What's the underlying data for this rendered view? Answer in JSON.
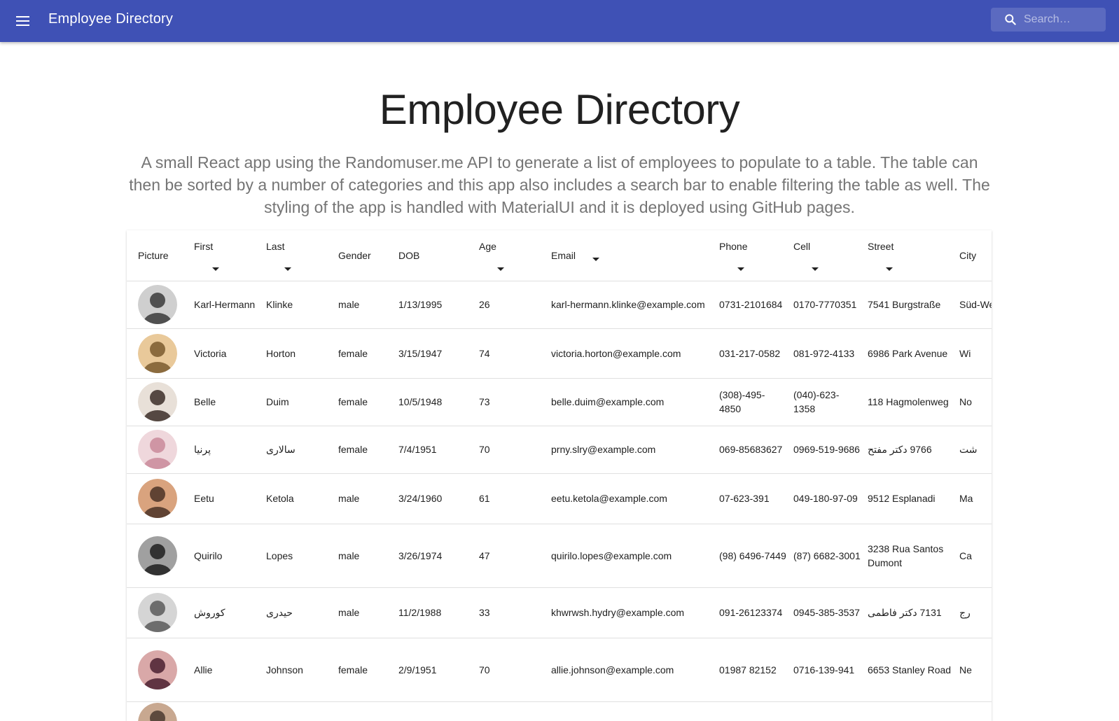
{
  "appbar": {
    "title": "Employee Directory",
    "menu_icon": "hamburger-menu-icon",
    "search_icon": "search-icon",
    "search_placeholder": "Search…",
    "search_value": ""
  },
  "hero": {
    "title": "Employee Directory",
    "description": "A small React app using the Randomuser.me API to generate a list of employees to populate to a table. The table can then be sorted by a number of categories and this app also includes a search bar to enable filtering the table as well. The styling of the app is handled with MaterialUI and it is deployed using GitHub pages."
  },
  "colors": {
    "appbar": "#3f51b5",
    "text": "#212121",
    "muted": "#757575",
    "divider": "#e0e0e0"
  },
  "table": {
    "columns": [
      "Picture",
      "First",
      "Last",
      "Gender",
      "DOB",
      "Age",
      "Email",
      "Phone",
      "Cell",
      "Street",
      "City"
    ],
    "sortable": [
      "First",
      "Last",
      "Age",
      "Email",
      "Phone",
      "Cell",
      "Street"
    ],
    "rows": [
      {
        "first": "Karl-Hermann",
        "last": "Klinke",
        "gender": "male",
        "dob": "1/13/1995",
        "age": "26",
        "email": "karl-hermann.klinke@example.com",
        "phone": "0731-2101684",
        "cell": "0170-7770351",
        "street": "7541 Burgstraße",
        "city": "Süd-West"
      },
      {
        "first": "Victoria",
        "last": "Horton",
        "gender": "female",
        "dob": "3/15/1947",
        "age": "74",
        "email": "victoria.horton@example.com",
        "phone": "031-217-0582",
        "cell": "081-972-4133",
        "street": "6986 Park Avenue",
        "city": "Wi"
      },
      {
        "first": "Belle",
        "last": "Duim",
        "gender": "female",
        "dob": "10/5/1948",
        "age": "73",
        "email": "belle.duim@example.com",
        "phone": "(308)-495-4850",
        "cell": "(040)-623-1358",
        "street": "118 Hagmolenweg",
        "city": "No"
      },
      {
        "first": "پرنیا",
        "last": "سالاری",
        "gender": "female",
        "dob": "7/4/1951",
        "age": "70",
        "email": "prny.slry@example.com",
        "phone": "069-85683627",
        "cell": "0969-519-9686",
        "street": "9766 دکتر مفتح",
        "city": "شت"
      },
      {
        "first": "Eetu",
        "last": "Ketola",
        "gender": "male",
        "dob": "3/24/1960",
        "age": "61",
        "email": "eetu.ketola@example.com",
        "phone": "07-623-391",
        "cell": "049-180-97-09",
        "street": "9512 Esplanadi",
        "city": "Ma"
      },
      {
        "first": "Quirilo",
        "last": "Lopes",
        "gender": "male",
        "dob": "3/26/1974",
        "age": "47",
        "email": "quirilo.lopes@example.com",
        "phone": "(98) 6496-7449",
        "cell": "(87) 6682-3001",
        "street": "3238 Rua Santos Dumont",
        "city": "Ca"
      },
      {
        "first": "کوروش",
        "last": "حیدری",
        "gender": "male",
        "dob": "11/2/1988",
        "age": "33",
        "email": "khwrwsh.hydry@example.com",
        "phone": "091-26123374",
        "cell": "0945-385-3537",
        "street": "7131 دکتر فاطمی",
        "city": "رج"
      },
      {
        "first": "Allie",
        "last": "Johnson",
        "gender": "female",
        "dob": "2/9/1951",
        "age": "70",
        "email": "allie.johnson@example.com",
        "phone": "01987 82152",
        "cell": "0716-139-941",
        "street": "6653 Stanley Road",
        "city": "Ne"
      },
      {
        "first": "",
        "last": "",
        "gender": "",
        "dob": "",
        "age": "",
        "email": "",
        "phone": "",
        "cell": "",
        "street": "",
        "city": ""
      }
    ]
  }
}
